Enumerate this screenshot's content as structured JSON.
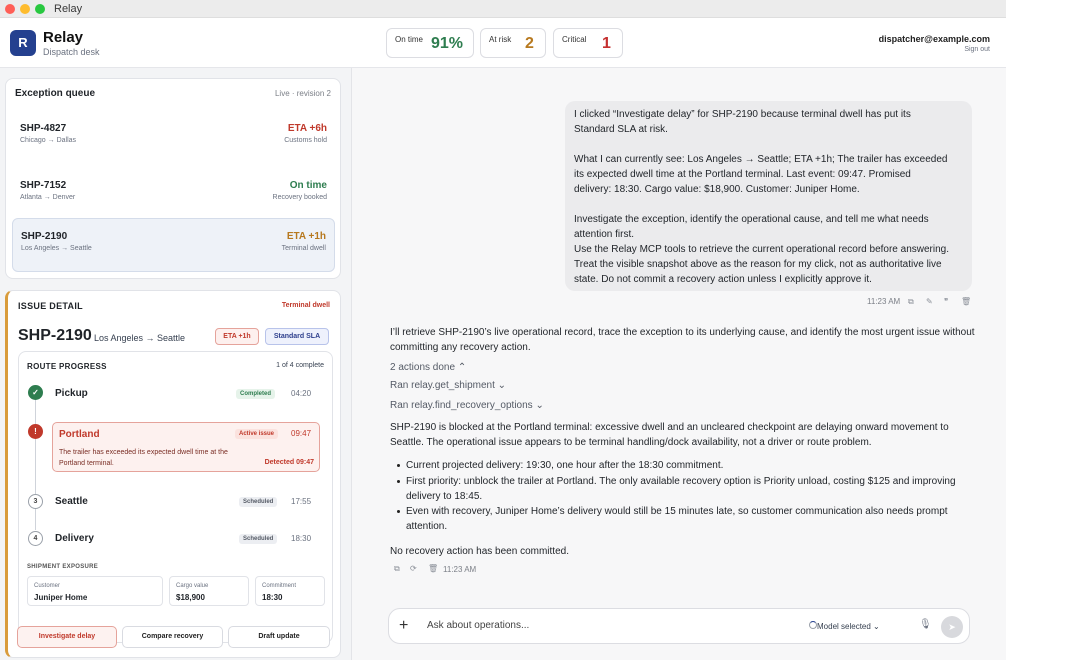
{
  "window": {
    "title": "Relay"
  },
  "header": {
    "logo_letter": "R",
    "brand": "Relay",
    "subtitle": "Dispatch desk",
    "metrics": [
      {
        "label": "On time",
        "value": "91%"
      },
      {
        "label": "At risk",
        "value": "2"
      },
      {
        "label": "Critical",
        "value": "1"
      }
    ],
    "user_email": "dispatcher@example.com",
    "sign_out": "Sign out"
  },
  "queue": {
    "title": "Exception queue",
    "live": "Live · revision 2",
    "items": [
      {
        "id": "SHP-4827",
        "route": "Chicago → Dallas",
        "eta": "ETA +6h",
        "note": "Customs hold",
        "color": "#c0392b"
      },
      {
        "id": "SHP-7152",
        "route": "Atlanta → Denver",
        "eta": "On time",
        "note": "Recovery booked",
        "color": "#2e7d4f"
      },
      {
        "id": "SHP-2190",
        "route": "Los Angeles → Seattle",
        "eta": "ETA +1h",
        "note": "Terminal dwell",
        "color": "#b7791f"
      }
    ]
  },
  "detail": {
    "label": "ISSUE DETAIL",
    "tag": "Terminal dwell",
    "id": "SHP-2190",
    "route": "Los Angeles → Seattle",
    "eta_pill": "ETA +1h",
    "sla_pill": "Standard SLA",
    "route_progress": {
      "title": "ROUTE PROGRESS",
      "count": "1 of 4 complete",
      "steps": [
        {
          "icon": "✓",
          "name": "Pickup",
          "badge": "Completed",
          "time": "04:20"
        },
        {
          "icon": "!",
          "name": "Portland",
          "badge": "Active issue",
          "time": "09:47",
          "description": "The trailer has exceeded its expected dwell time at the Portland terminal.",
          "detected": "Detected 09:47"
        },
        {
          "icon": "3",
          "name": "Seattle",
          "badge": "Scheduled",
          "time": "17:55"
        },
        {
          "icon": "4",
          "name": "Delivery",
          "badge": "Scheduled",
          "time": "18:30"
        }
      ]
    },
    "exposure": {
      "title": "SHIPMENT EXPOSURE",
      "fields": [
        {
          "label": "Customer",
          "value": "Juniper Home"
        },
        {
          "label": "Cargo value",
          "value": "$18,900"
        },
        {
          "label": "Commitment",
          "value": "18:30"
        }
      ]
    },
    "actions": [
      "Investigate delay",
      "Compare recovery",
      "Draft update"
    ]
  },
  "chat": {
    "user_message": [
      "I clicked “Investigate delay” for SHP-2190 because terminal dwell has put its",
      "Standard SLA at risk.",
      "",
      "What I can currently see: Los Angeles → Seattle; ETA +1h; The trailer has exceeded",
      "its expected dwell time at the Portland terminal. Last event: 09:47. Promised",
      "delivery: 18:30. Cargo value: $18,900. Customer: Juniper Home.",
      "",
      "Investigate the exception, identify the operational cause, and tell me what needs",
      "attention first.",
      "Use the Relay MCP tools to retrieve the current operational record before answering.",
      "Treat the visible snapshot above as the reason for my click, not as authoritative live",
      "state. Do not commit a recovery action unless I explicitly approve it."
    ],
    "user_time": "11:23 AM",
    "assistant_intro": "I’ll retrieve SHP-2190’s live operational record, trace the exception to its underlying cause, and identify the most urgent issue without committing any recovery action.",
    "actions_done": "2 actions done",
    "tool_1": "Ran relay.get_shipment",
    "tool_2": "Ran relay.find_recovery_options",
    "assistant_body": "SHP-2190 is blocked at the Portland terminal: excessive dwell and an uncleared checkpoint are delaying onward movement to Seattle. The operational issue appears to be terminal handling/dock availability, not a driver or route problem.",
    "bullets": [
      "Current projected delivery: 19:30, one hour after the 18:30 commitment.",
      "First priority: unblock the trailer at Portland. The only available recovery option is Priority unload, costing $125 and improving delivery to 18:45.",
      "Even with recovery, Juniper Home’s delivery would still be 15 minutes late, so customer communication also needs prompt attention."
    ],
    "closing": "No recovery action has been committed.",
    "assistant_time": "11:23 AM",
    "composer_placeholder": "Ask about operations...",
    "model": "Model selected"
  }
}
